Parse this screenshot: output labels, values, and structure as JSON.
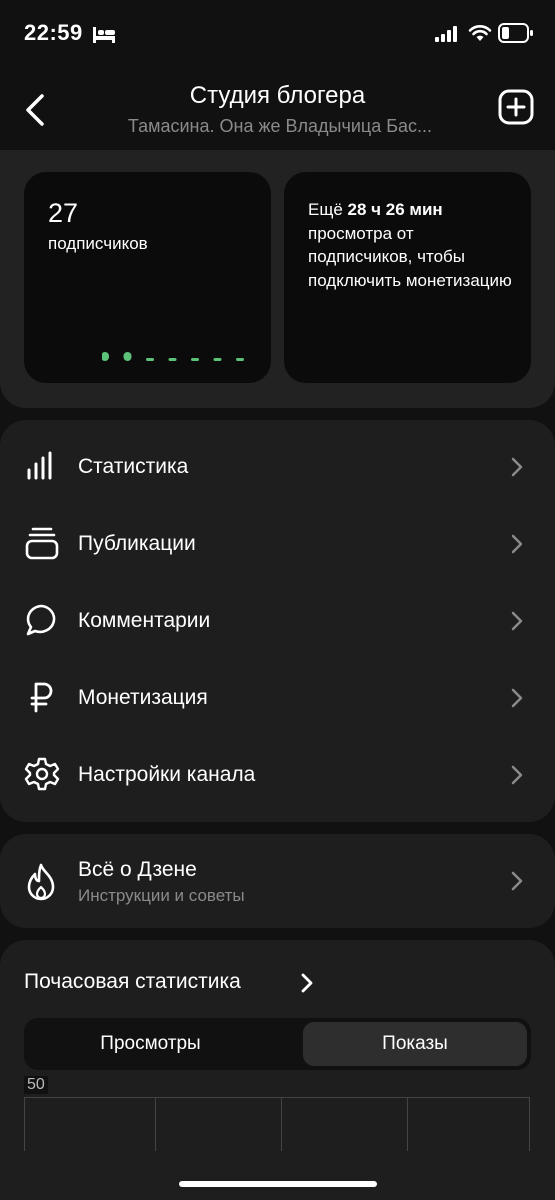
{
  "status_bar": {
    "time": "22:59"
  },
  "header": {
    "title": "Студия блогера",
    "subtitle": "Тамасина. Она же Владычица Бас..."
  },
  "subscribers": {
    "count": "27",
    "label": "подписчиков",
    "trend": [
      1,
      1,
      0,
      0,
      0,
      0,
      0
    ]
  },
  "monetization_card": {
    "prefix": "Ещё ",
    "time_left": "28 ч 26 мин",
    "rest": "просмотра от подписчиков, чтобы подключить монетизацию"
  },
  "menu": {
    "items": [
      {
        "label": "Статистика",
        "icon": "bar-chart-icon"
      },
      {
        "label": "Публикации",
        "icon": "stack-icon"
      },
      {
        "label": "Комментарии",
        "icon": "comment-bubble-icon"
      },
      {
        "label": "Монетизация",
        "icon": "ruble-icon"
      },
      {
        "label": "Настройки канала",
        "icon": "gear-icon"
      }
    ]
  },
  "dzen": {
    "title": "Всё о Дзене",
    "subtitle": "Инструкции и советы",
    "icon": "flame-icon"
  },
  "hourly": {
    "title": "Почасовая статистика",
    "tabs": [
      "Просмотры",
      "Показы"
    ],
    "selected_tab": "Показы",
    "y_tick": "50"
  },
  "colors": {
    "background": "#111111",
    "panel": "#1e1e1e",
    "accent_green": "#5cc27a",
    "muted_text": "#8a8a8a"
  }
}
